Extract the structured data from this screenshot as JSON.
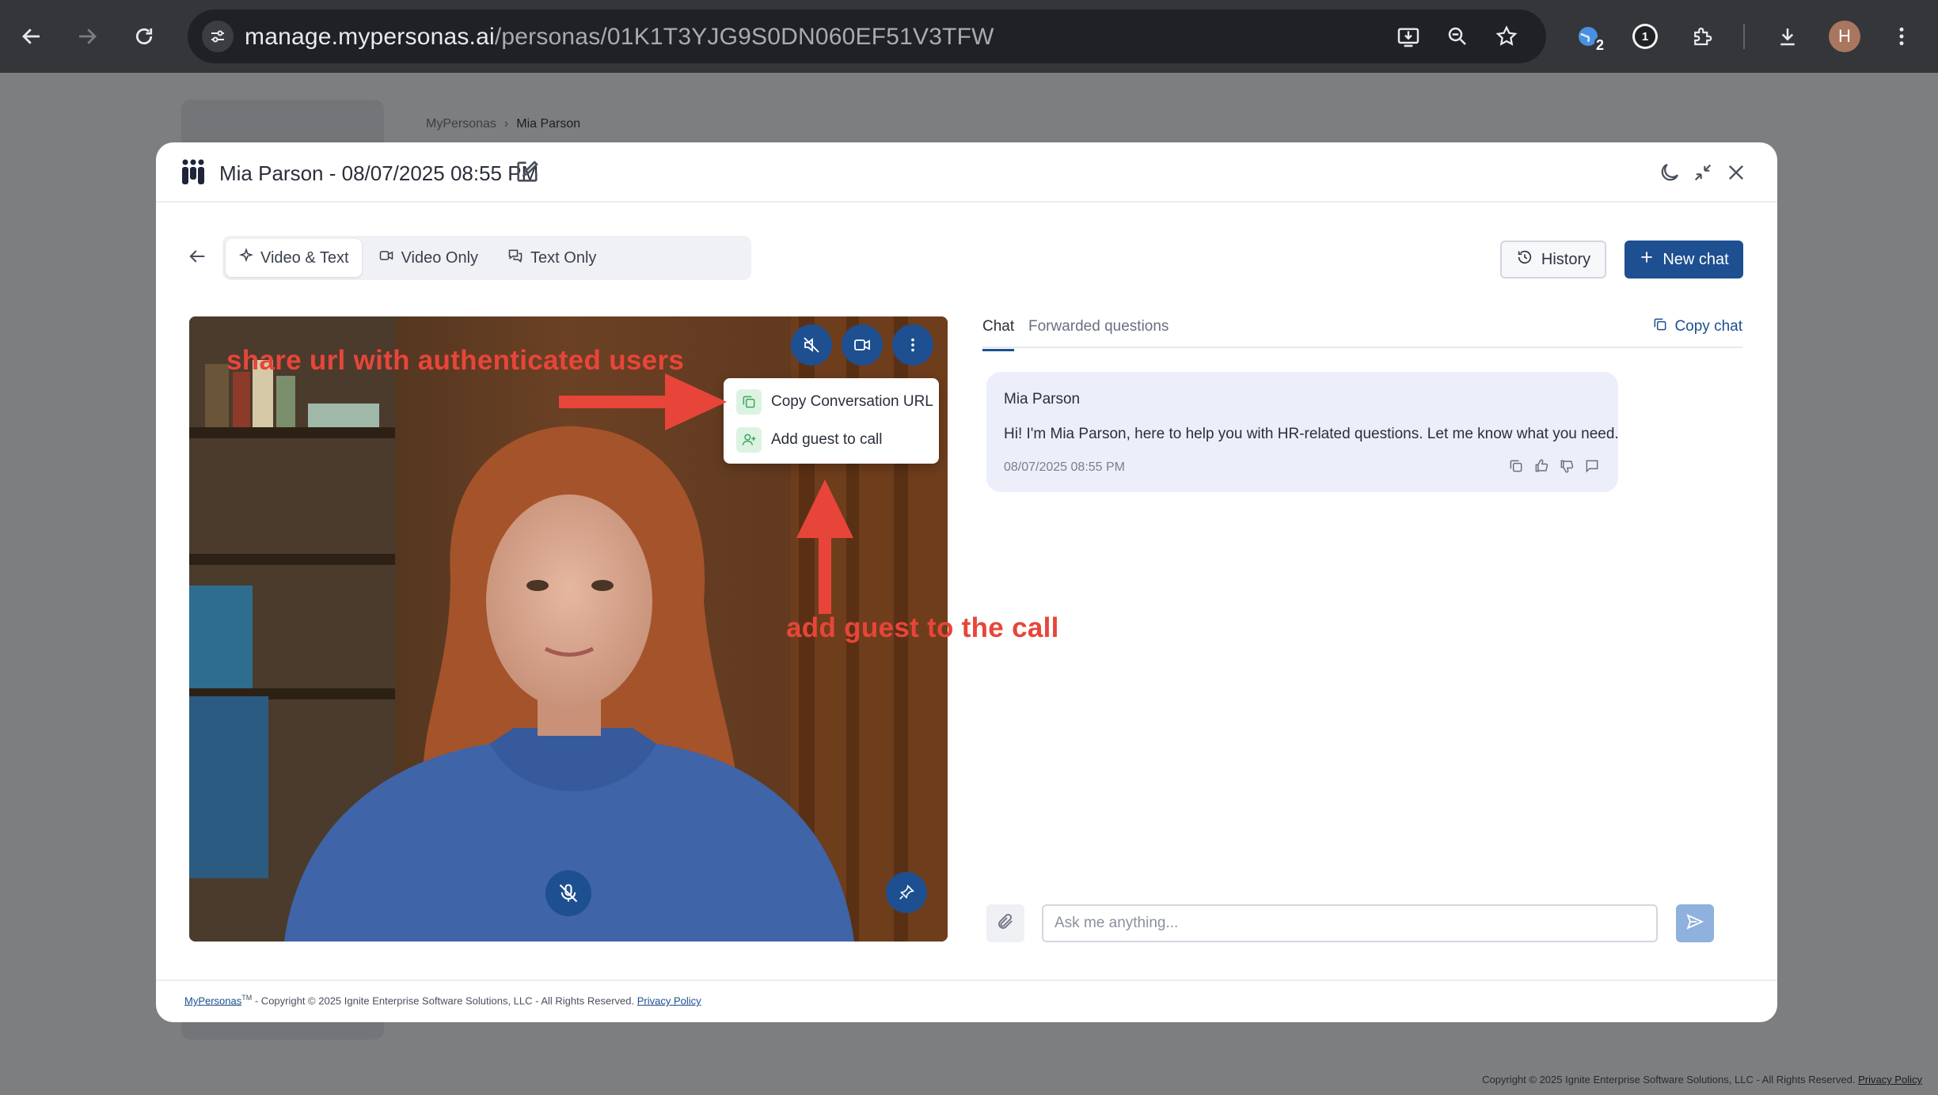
{
  "browser": {
    "url_host": "manage.mypersonas.ai",
    "url_path": "/personas/01K1T3YJG9S0DN060EF51V3TFW",
    "extension_badge": "2",
    "extension_counter": "1",
    "profile_initial": "H"
  },
  "background_page": {
    "breadcrumb": [
      "MyPersonas",
      "Mia Parson"
    ],
    "footer_text": "Copyright © 2025 Ignite Enterprise Software Solutions, LLC - All Rights Reserved.",
    "footer_link": "Privacy Policy"
  },
  "modal": {
    "title": "Mia Parson - 08/07/2025 08:55 PM",
    "mode_tabs": [
      {
        "label": "Video & Text",
        "icon": "sparkle-icon",
        "active": true
      },
      {
        "label": "Video Only",
        "icon": "video-icon",
        "active": false
      },
      {
        "label": "Text Only",
        "icon": "chat-icon",
        "active": false
      }
    ],
    "history_label": "History",
    "new_chat_label": "New chat",
    "video_menu": {
      "items": [
        {
          "label": "Copy Conversation URL",
          "icon": "copy-icon"
        },
        {
          "label": "Add guest to call",
          "icon": "add-user-icon"
        }
      ]
    },
    "chat": {
      "tabs": [
        {
          "label": "Chat",
          "active": true
        },
        {
          "label": "Forwarded questions",
          "active": false
        }
      ],
      "copy_chat_label": "Copy chat",
      "messages": [
        {
          "sender": "Mia Parson",
          "text": "Hi! I'm Mia Parson, here to help you with HR-related questions. Let me know what you need.",
          "timestamp": "08/07/2025 08:55 PM"
        }
      ],
      "input_placeholder": "Ask me anything..."
    },
    "footer": {
      "brand": "MyPersonas",
      "tm": "TM",
      "copyright": " - Copyright © 2025 Ignite Enterprise Software Solutions, LLC - All Rights Reserved. ",
      "privacy_link": "Privacy Policy"
    }
  },
  "annotations": {
    "share_url": "share url with authenticated users",
    "add_guest": "add guest to the call",
    "color": "#e8453a"
  },
  "colors": {
    "primary": "#1d4f91",
    "bubble": "#eceffa",
    "chrome": "#35363a"
  }
}
